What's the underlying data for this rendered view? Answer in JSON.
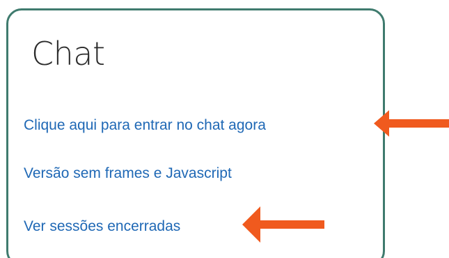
{
  "block": {
    "title": "Chat",
    "links": [
      {
        "label": "Clique aqui para entrar no chat agora"
      },
      {
        "label": "Versão sem frames e Javascript"
      },
      {
        "label": "Ver sessões encerradas"
      }
    ]
  },
  "colors": {
    "border": "#3f7b6e",
    "link": "#1f68b5",
    "arrow": "#f05a1e",
    "title": "#2b2b2b"
  },
  "icons": {
    "arrow_1": "left-arrow-icon",
    "arrow_2": "left-arrow-icon"
  }
}
